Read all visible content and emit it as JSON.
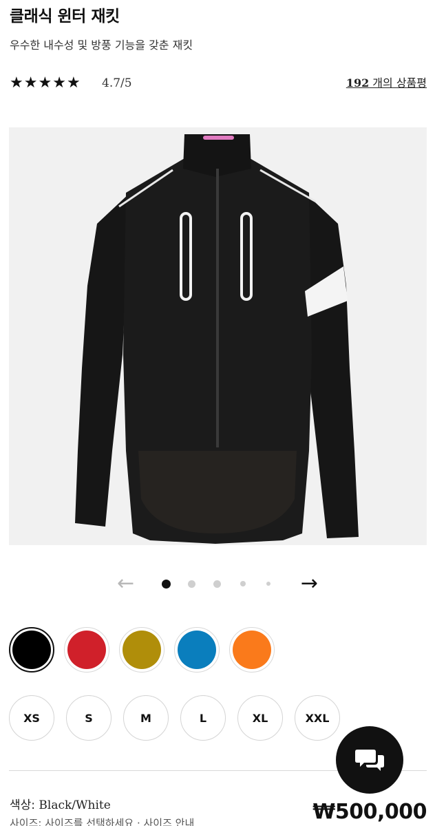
{
  "product": {
    "title": "클래식 윈터 재킷",
    "subtitle": "우수한 내수성 및 방풍 기능을 갖춘 재킷"
  },
  "rating": {
    "value": 4.7,
    "text": "4.7/5",
    "review_count": "192",
    "review_suffix": " 개의 상품평"
  },
  "gallery": {
    "prev_arrow": "←",
    "next_arrow": "→",
    "total_images": 5,
    "current_index": 1
  },
  "colors": {
    "swatches": [
      {
        "name": "black",
        "hex": "#000000",
        "selected": true
      },
      {
        "name": "red",
        "hex": "#d0202a",
        "selected": false
      },
      {
        "name": "olive",
        "hex": "#b08e0a",
        "selected": false
      },
      {
        "name": "blue",
        "hex": "#0a7ebd",
        "selected": false
      },
      {
        "name": "orange",
        "hex": "#fa7a1b",
        "selected": false
      }
    ],
    "label": "색상: ",
    "selected_value": "Black/White"
  },
  "sizes": [
    "XS",
    "S",
    "M",
    "L",
    "XL",
    "XXL"
  ],
  "size_hint": "사이즈: 사이즈를 선택하세요 · 사이즈 안내",
  "price": "₩500,000",
  "icons": {
    "star": "star-icon",
    "chat": "chat-bubbles-icon"
  }
}
